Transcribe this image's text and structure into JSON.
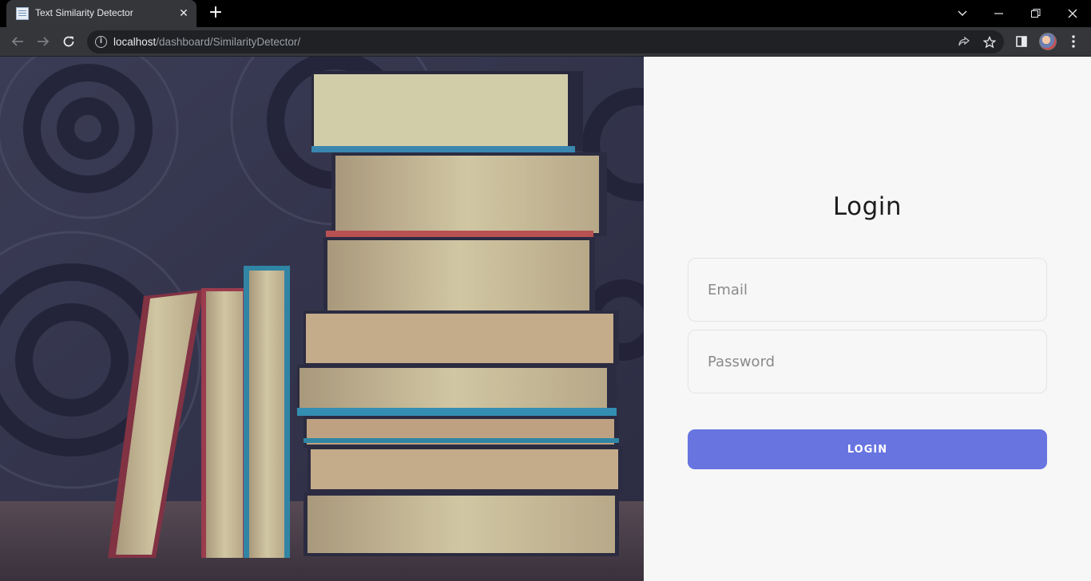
{
  "browser": {
    "tab_title": "Text Similarity Detector",
    "url_host": "localhost",
    "url_path": "/dashboard/SimilarityDetector/"
  },
  "login": {
    "title": "Login",
    "email_placeholder": "Email",
    "password_placeholder": "Password",
    "button_label": "LOGIN"
  },
  "colors": {
    "accent": "#6874e0",
    "panel_bg": "#f7f7f7"
  }
}
